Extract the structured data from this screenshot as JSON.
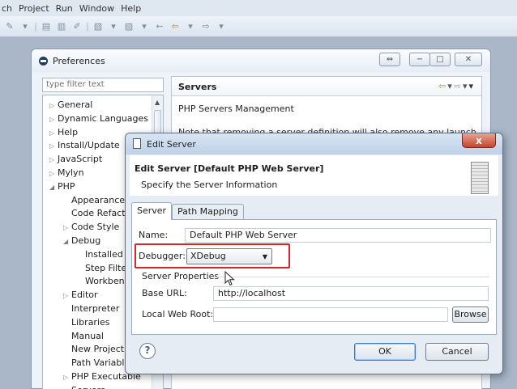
{
  "menubar": {
    "items": [
      "ch",
      "Project",
      "Run",
      "Window",
      "Help"
    ]
  },
  "preferences": {
    "title": "Preferences",
    "filter_placeholder": "type filter text",
    "tree": [
      {
        "label": "General",
        "arrow": "▷"
      },
      {
        "label": "Dynamic Languages",
        "arrow": "▷"
      },
      {
        "label": "Help",
        "arrow": "▷"
      },
      {
        "label": "Install/Update",
        "arrow": "▷"
      },
      {
        "label": "JavaScript",
        "arrow": "▷"
      },
      {
        "label": "Mylyn",
        "arrow": "▷"
      },
      {
        "label": "PHP",
        "arrow": "◢"
      },
      {
        "label": "Appearance",
        "arrow": ""
      },
      {
        "label": "Code Refacto",
        "arrow": ""
      },
      {
        "label": "Code Style",
        "arrow": "▷"
      },
      {
        "label": "Debug",
        "arrow": "◢"
      },
      {
        "label": "Installed I",
        "arrow": ""
      },
      {
        "label": "Step Filte",
        "arrow": ""
      },
      {
        "label": "Workben",
        "arrow": ""
      },
      {
        "label": "Editor",
        "arrow": "▷"
      },
      {
        "label": "Interpreter",
        "arrow": ""
      },
      {
        "label": "Libraries",
        "arrow": ""
      },
      {
        "label": "Manual",
        "arrow": ""
      },
      {
        "label": "New Project",
        "arrow": ""
      },
      {
        "label": "Path Variable",
        "arrow": ""
      },
      {
        "label": "PHP Executable",
        "arrow": "▷"
      },
      {
        "label": "Servers",
        "arrow": ""
      }
    ],
    "page_title": "Servers",
    "page_desc": "PHP Servers Management",
    "page_note": "Note that removing a server definition will also remove any launch"
  },
  "dialog": {
    "title": "Edit Server",
    "close_label": "x",
    "header_title": "Edit Server [Default PHP Web Server]",
    "header_subtitle": "Specify the Server Information",
    "tabs": [
      "Server",
      "Path Mapping"
    ],
    "name_label": "Name:",
    "name_value": "Default PHP Web Server",
    "debugger_label": "Debugger:",
    "debugger_value": "XDebug",
    "group_label": "Server Properties",
    "base_url_label": "Base URL:",
    "base_url_value": "http://localhost",
    "local_root_label": "Local Web Root:",
    "local_root_value": "",
    "browse_label": "Browse",
    "help_label": "?",
    "ok_label": "OK",
    "cancel_label": "Cancel"
  },
  "colors": {
    "highlight": "#d8242a",
    "accent": "#3b7ac4"
  }
}
